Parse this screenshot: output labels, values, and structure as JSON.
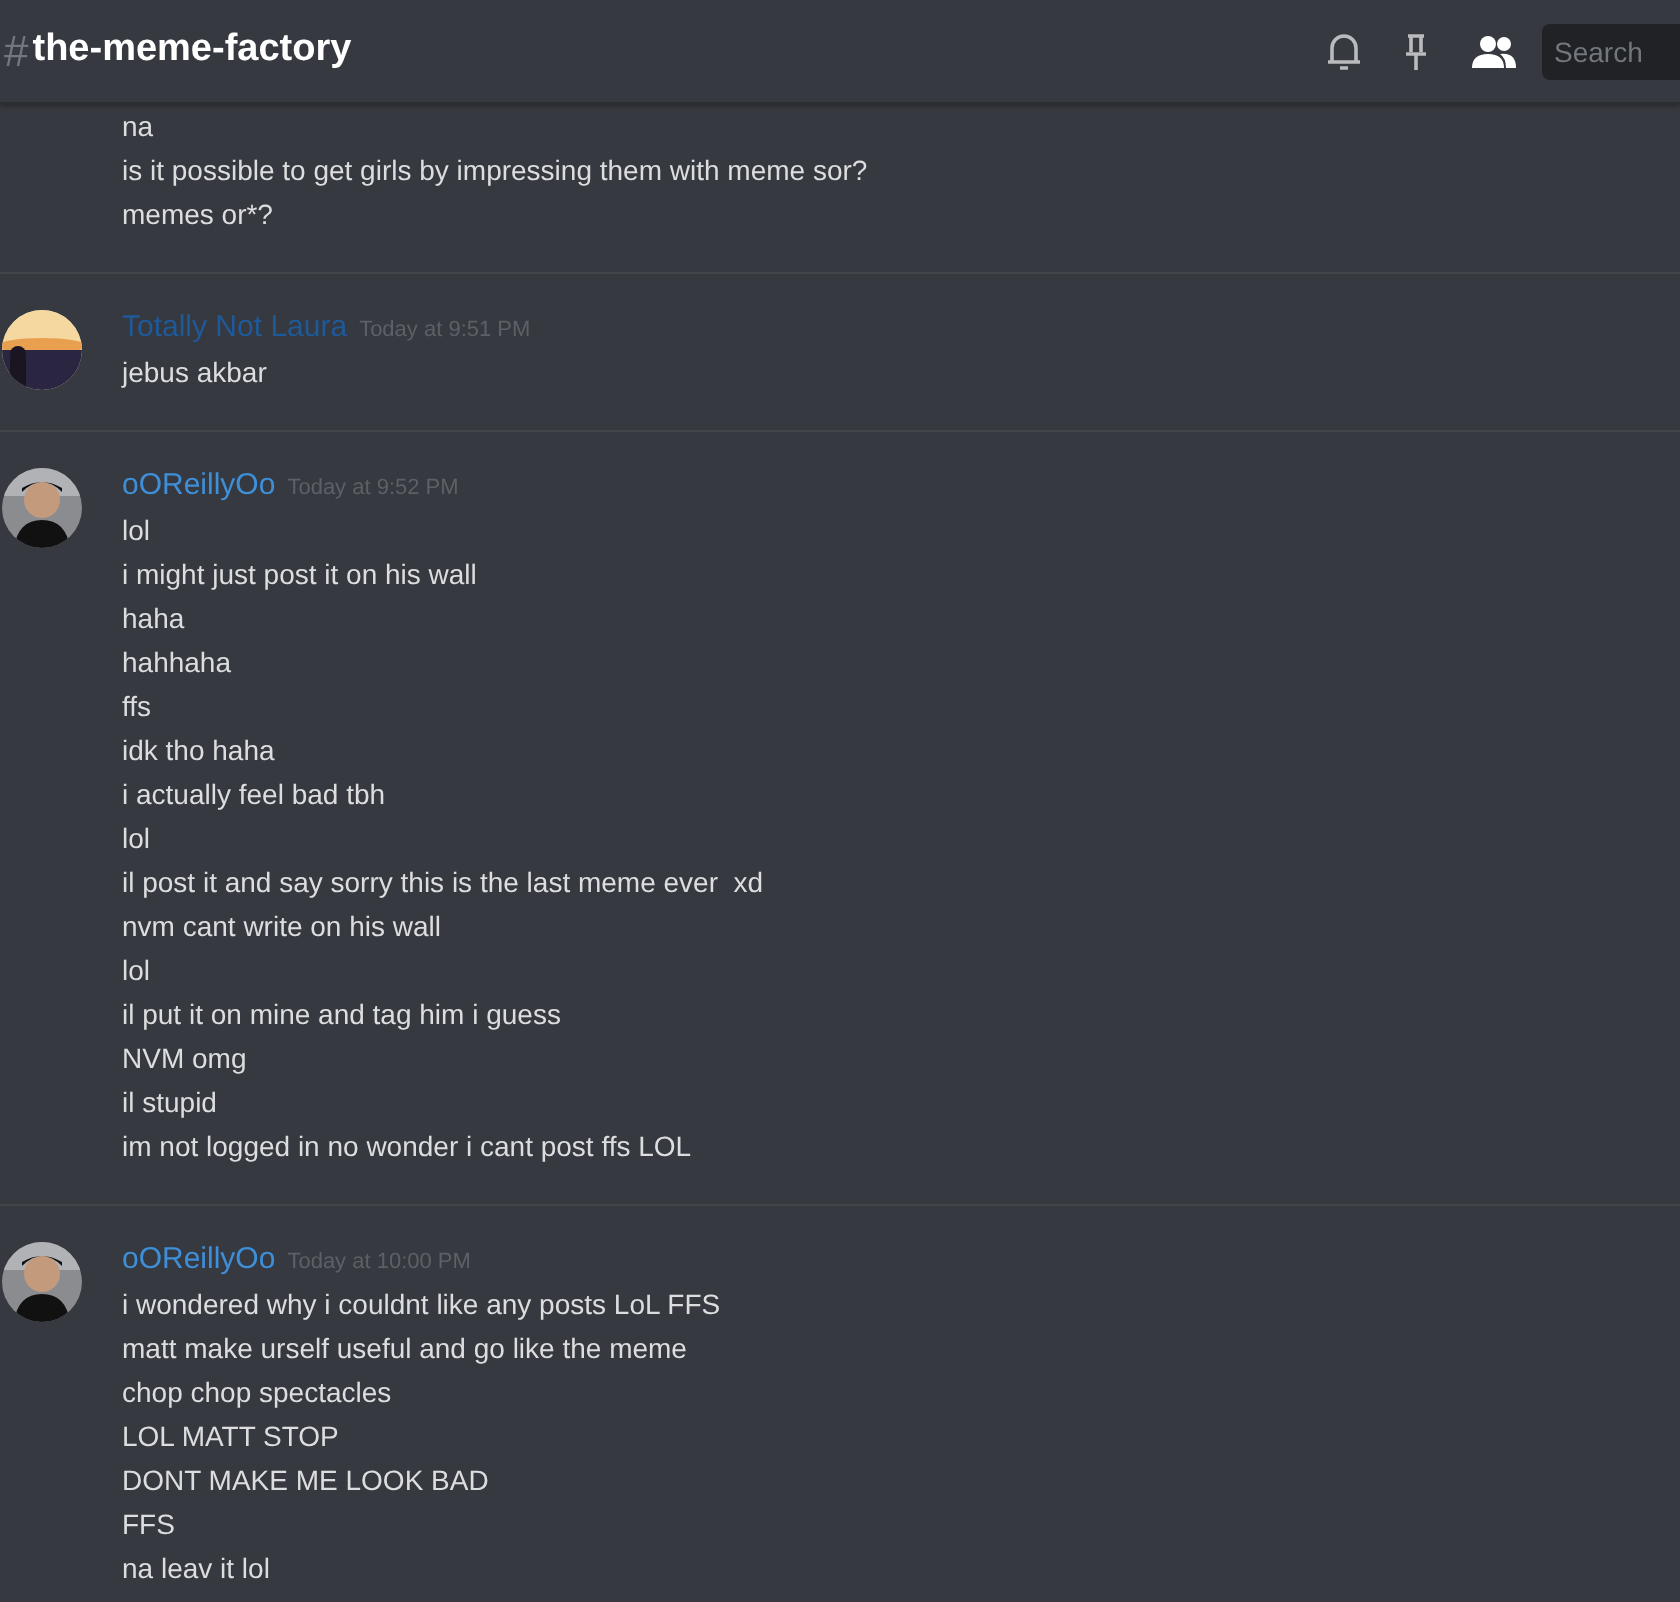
{
  "channel": {
    "hash": "#",
    "name": "the-meme-factory"
  },
  "search": {
    "placeholder": "Search"
  },
  "messages": [
    {
      "lines": [
        "na",
        "is it possible to get girls by impressing them with meme sor?",
        "memes or*?"
      ]
    },
    {
      "author": "Totally Not Laura",
      "color": "#1e5a9a",
      "time": "Today at 9:51 PM",
      "lines": [
        "jebus akbar"
      ]
    },
    {
      "author": "oOReillyOo",
      "color": "#3e8ed8",
      "time": "Today at 9:52 PM",
      "lines": [
        "lol",
        "i might just post it on his wall",
        "haha",
        "hahhaha",
        "ffs",
        "idk tho haha",
        "i actually feel bad tbh",
        "lol",
        "il post it and say sorry this is the last meme ever  xd",
        "nvm cant write on his wall",
        "lol",
        "il put it on mine and tag him i guess",
        "NVM omg",
        "il stupid",
        "im not logged in no wonder i cant post ffs LOL"
      ]
    },
    {
      "author": "oOReillyOo",
      "color": "#3e8ed8",
      "time": "Today at 10:00 PM",
      "lines": [
        "i wondered why i couldnt like any posts LoL FFS",
        "matt make urself useful and go like the meme",
        "chop chop spectacles",
        "LOL MATT STOP",
        "DONT MAKE ME LOOK BAD",
        "FFS",
        "na leav it lol"
      ]
    }
  ]
}
